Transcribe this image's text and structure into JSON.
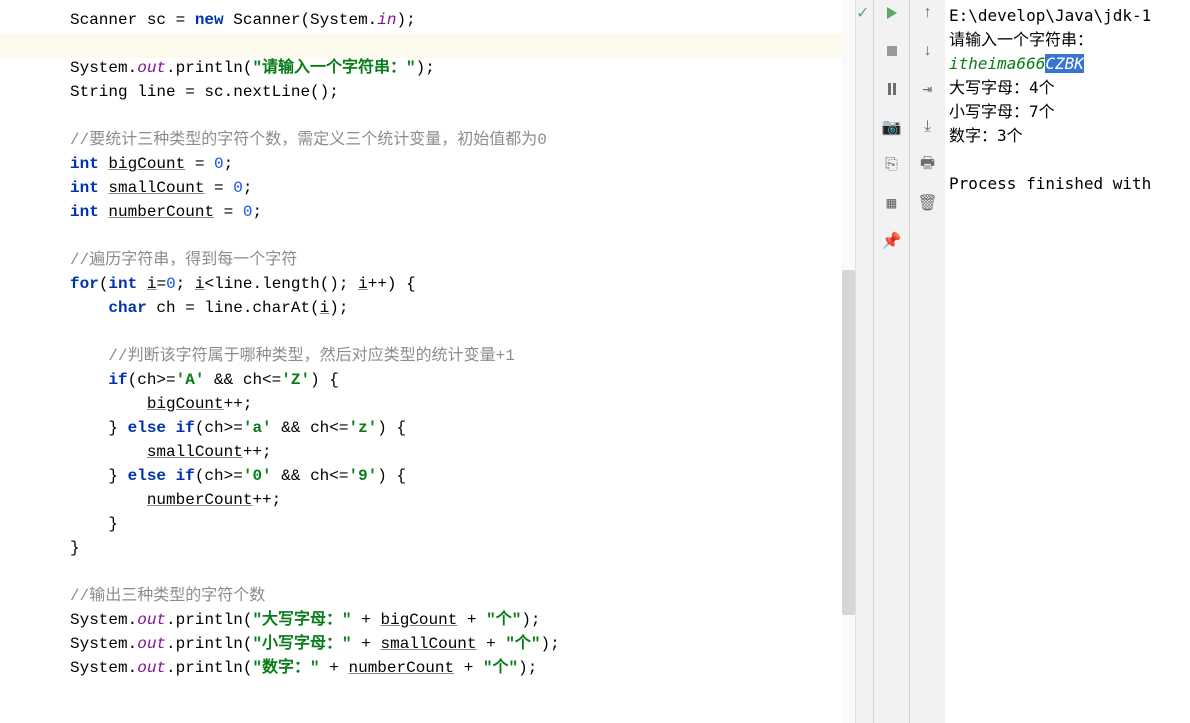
{
  "code": {
    "l1a": "Scanner sc = ",
    "l1b": "new",
    "l1c": " Scanner(System.",
    "l1d": "in",
    "l1e": ");",
    "l2a": "System.",
    "l2b": "out",
    "l2c": ".println(",
    "l2d": "\"请输入一个字符串：\"",
    "l2e": ");",
    "l3": "String line = sc.nextLine();",
    "c1": "//要统计三种类型的字符个数，需定义三个统计变量，初始值都为0",
    "l4a": "int",
    "l4b": " ",
    "l4c": "bigCount",
    "l4d": " = ",
    "l4e": "0",
    "l4f": ";",
    "l5a": "int",
    "l5c": "smallCount",
    "l5e": "0",
    "l6a": "int",
    "l6c": "numberCount",
    "l6e": "0",
    "c2": "//遍历字符串，得到每一个字符",
    "l7a": "for",
    "l7b": "(",
    "l7c": "int",
    "l7d": " ",
    "l7e": "i",
    "l7f": "=",
    "l7g": "0",
    "l7h": "; ",
    "l7i": "i",
    "l7j": "<line.length(); ",
    "l7k": "i",
    "l7l": "++) {",
    "l8a": "char",
    "l8b": " ch = line.charAt(",
    "l8c": "i",
    "l8d": ");",
    "c3": "//判断该字符属于哪种类型，然后对应类型的统计变量+1",
    "l9a": "if",
    "l9b": "(ch>=",
    "l9c": "'A'",
    "l9d": " && ch<=",
    "l9e": "'Z'",
    "l9f": ") {",
    "l10a": "bigCount",
    "l10b": "++;",
    "l11a": "} ",
    "l11b": "else if",
    "l11c": "(ch>=",
    "l11d": "'a'",
    "l11e": " && ch<=",
    "l11f": "'z'",
    "l11g": ") {",
    "l12a": "smallCount",
    "l12b": "++;",
    "l13b": "else if",
    "l13d": "'0'",
    "l13f": "'9'",
    "l14a": "numberCount",
    "l15": "}",
    "l16": "}",
    "c4": "//输出三种类型的字符个数",
    "l17a": "System.",
    "l17b": "out",
    "l17c": ".println(",
    "l17d": "\"大写字母：\"",
    "l17e": " + ",
    "l17f": "bigCount",
    "l17g": " + ",
    "l17h": "\"个\"",
    "l17i": ");",
    "l18d": "\"小写字母：\"",
    "l18f": "smallCount",
    "l19d": "\"数字：\"",
    "l19f": "numberCount"
  },
  "console": {
    "path": "E:\\develop\\Java\\jdk-1",
    "prompt": "请输入一个字符串：",
    "input_plain": "itheima666",
    "input_sel": "CZBK",
    "out1": "大写字母：4个",
    "out2": "小写字母：7个",
    "out3": "数字：3个",
    "finished": "Process finished with"
  }
}
